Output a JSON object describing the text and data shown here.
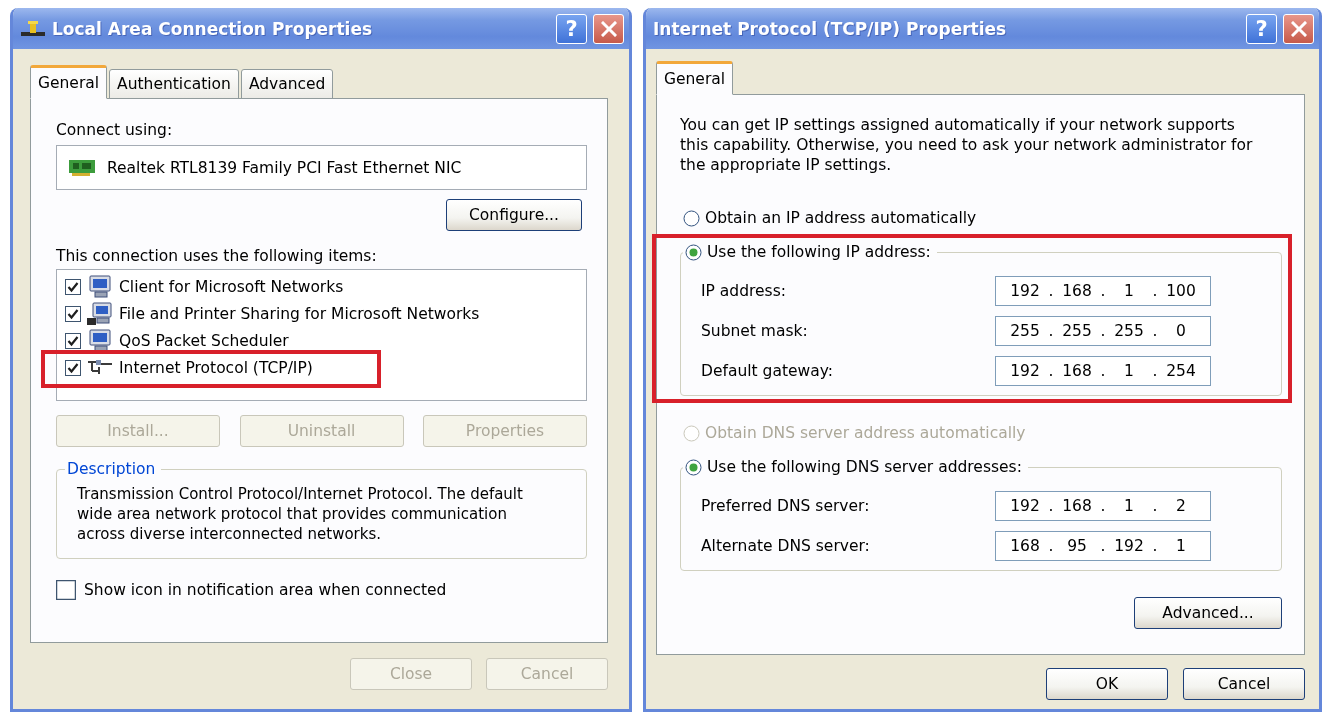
{
  "connection_dialog": {
    "title": "Local Area Connection Properties",
    "help_button": "?",
    "tabs": [
      {
        "label": "General",
        "selected": true
      },
      {
        "label": "Authentication",
        "selected": false
      },
      {
        "label": "Advanced",
        "selected": false
      }
    ],
    "connect_using_label": "Connect using:",
    "adapter": "Realtek RTL8139 Family PCI Fast Ethernet NIC",
    "configure_button": "Configure...",
    "items_label": "This connection uses the following items:",
    "components": [
      {
        "kind": "client",
        "label": "Client for Microsoft Networks",
        "checked": true,
        "highlighted": false
      },
      {
        "kind": "sharing",
        "label": "File and Printer Sharing for Microsoft Networks",
        "checked": true,
        "highlighted": false
      },
      {
        "kind": "service",
        "label": "QoS Packet Scheduler",
        "checked": true,
        "highlighted": false
      },
      {
        "kind": "protocol",
        "label": "Internet Protocol (TCP/IP)",
        "checked": true,
        "highlighted": true
      }
    ],
    "component_buttons": [
      {
        "label": "Install...",
        "disabled": true
      },
      {
        "label": "Uninstall",
        "disabled": true
      },
      {
        "label": "Properties",
        "disabled": true
      }
    ],
    "description": {
      "legend": "Description",
      "text": "Transmission Control Protocol/Internet Protocol. The default wide area network protocol that provides communication across diverse interconnected networks."
    },
    "notification_option": {
      "label": "Show icon in notification area when connected",
      "checked": false
    },
    "buttons": [
      {
        "label": "Close",
        "disabled": true
      },
      {
        "label": "Cancel",
        "disabled": true
      }
    ]
  },
  "tcpip_dialog": {
    "title": "Internet Protocol (TCP/IP) Properties",
    "help_button": "?",
    "tabs": [
      {
        "label": "General",
        "selected": true
      }
    ],
    "intro": "You can get IP settings assigned automatically if your network supports this capability. Otherwise, you need to ask your network administrator for the appropriate IP settings.",
    "ip_settings": {
      "highlighted": true,
      "options": [
        {
          "label": "Obtain an IP address automatically",
          "selected": false,
          "disabled": false
        },
        {
          "label": "Use the following IP address:",
          "selected": true,
          "disabled": false
        }
      ],
      "fields": [
        {
          "label": "IP address:",
          "segments": [
            "192",
            ".",
            "168",
            ".",
            "1",
            ".",
            "100"
          ]
        },
        {
          "label": "Subnet mask:",
          "segments": [
            "255",
            ".",
            "255",
            ".",
            "255",
            ".",
            "0"
          ]
        },
        {
          "label": "Default gateway:",
          "segments": [
            "192",
            ".",
            "168",
            ".",
            "1",
            ".",
            "254"
          ]
        }
      ]
    },
    "dns_settings": {
      "highlighted": false,
      "options": [
        {
          "label": "Obtain DNS server address automatically",
          "selected": false,
          "disabled": true
        },
        {
          "label": "Use the following DNS server addresses:",
          "selected": true,
          "disabled": false
        }
      ],
      "fields": [
        {
          "label": "Preferred DNS server:",
          "segments": [
            "192",
            ".",
            "168",
            ".",
            "1",
            ".",
            "2"
          ]
        },
        {
          "label": "Alternate DNS server:",
          "segments": [
            "168",
            ".",
            "95",
            ".",
            "192",
            ".",
            "1"
          ]
        }
      ]
    },
    "advanced_button": "Advanced...",
    "buttons": [
      {
        "label": "OK",
        "disabled": false
      },
      {
        "label": "Cancel",
        "disabled": false
      }
    ]
  }
}
